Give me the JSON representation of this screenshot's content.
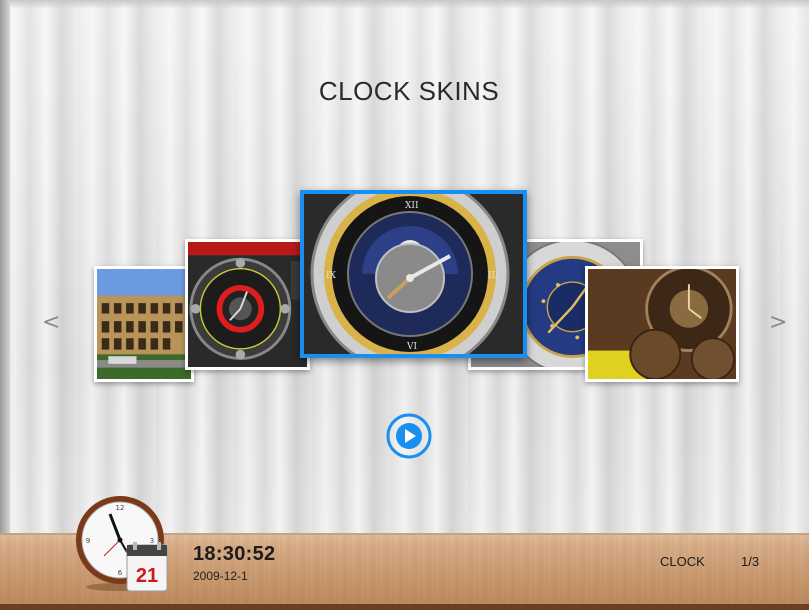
{
  "app": {
    "title": "CLOCK SKINS"
  },
  "carousel": {
    "prev_label": "<",
    "next_label": ">",
    "selected_index": 2,
    "items": [
      {
        "name": "colosseum"
      },
      {
        "name": "red-gauge-clock"
      },
      {
        "name": "moon-phase-clock"
      },
      {
        "name": "astronomical-clock"
      },
      {
        "name": "gear-clock"
      }
    ]
  },
  "play_button": {
    "icon": "play-icon"
  },
  "status_bar": {
    "time": "18:30:52",
    "date": "2009-12-1",
    "calendar_day": "21",
    "mode_label": "CLOCK",
    "page_indicator": "1/3"
  },
  "colors": {
    "accent": "#1a8ff0",
    "title": "#2b2b2b",
    "wood": "#c9996f"
  }
}
